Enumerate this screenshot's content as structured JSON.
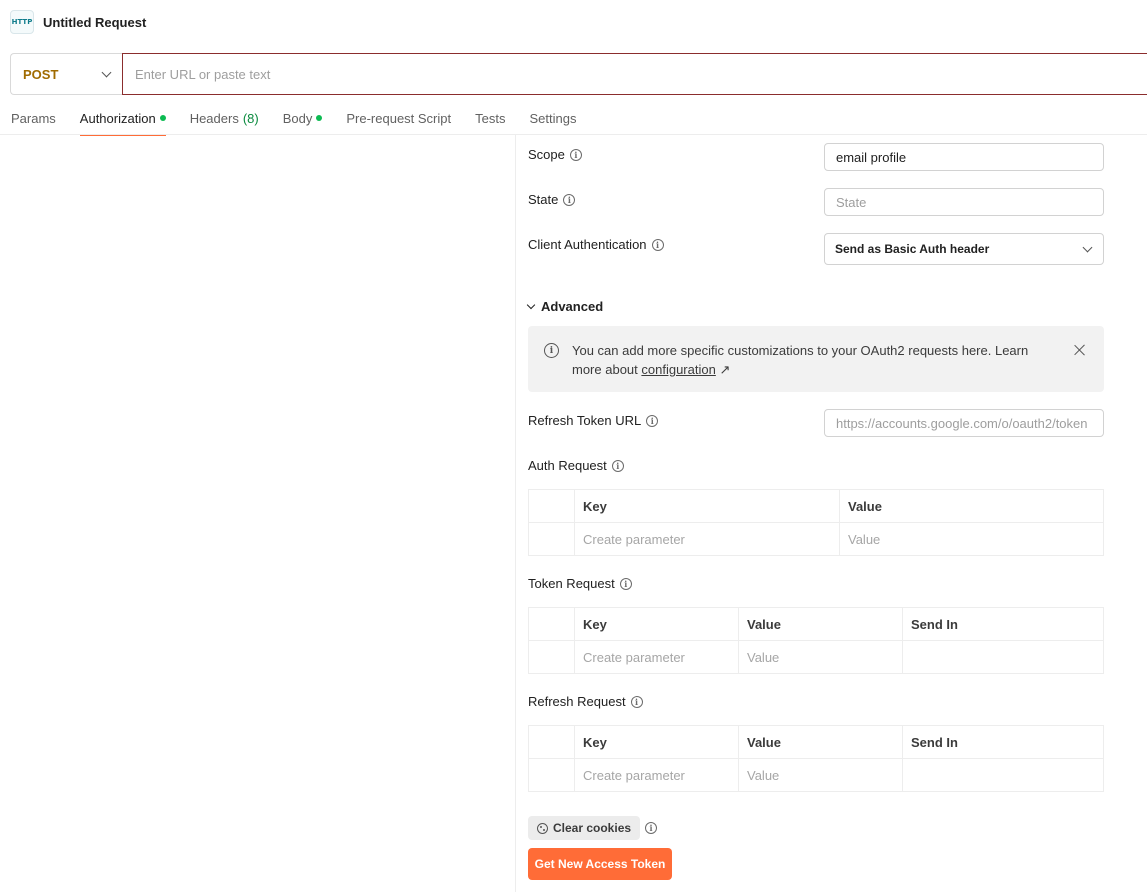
{
  "header": {
    "icon_text": "HTTP",
    "title": "Untitled Request"
  },
  "request": {
    "method": "POST",
    "url_placeholder": "Enter URL or paste text",
    "url_value": ""
  },
  "tabs": [
    {
      "label": "Params"
    },
    {
      "label": "Authorization",
      "dot": true,
      "active": true
    },
    {
      "label": "Headers",
      "count": "(8)"
    },
    {
      "label": "Body",
      "dot": true
    },
    {
      "label": "Pre-request Script"
    },
    {
      "label": "Tests"
    },
    {
      "label": "Settings"
    }
  ],
  "auth": {
    "scope": {
      "label": "Scope",
      "value": "email profile"
    },
    "state": {
      "label": "State",
      "placeholder": "State"
    },
    "client_auth": {
      "label": "Client Authentication",
      "value": "Send as Basic Auth header"
    },
    "advanced_label": "Advanced",
    "notice": {
      "text": "You can add more specific customizations to your OAuth2 requests here. Learn more about",
      "link": "configuration",
      "link_arrow": "↗"
    },
    "refresh_token_url": {
      "label": "Refresh Token URL",
      "placeholder": "https://accounts.google.com/o/oauth2/token"
    },
    "auth_request": {
      "label": "Auth Request",
      "headers": [
        "Key",
        "Value"
      ],
      "row": [
        "Create parameter",
        "Value"
      ]
    },
    "token_request": {
      "label": "Token Request",
      "headers": [
        "Key",
        "Value",
        "Send In"
      ],
      "row": [
        "Create parameter",
        "Value",
        ""
      ]
    },
    "refresh_request": {
      "label": "Refresh Request",
      "headers": [
        "Key",
        "Value",
        "Send In"
      ],
      "row": [
        "Create parameter",
        "Value",
        ""
      ]
    },
    "clear_cookies": "Clear cookies",
    "get_token": "Get New Access Token"
  },
  "colors": {
    "accent": "#ff6c37",
    "method": "#a06b00",
    "dot": "#0cbb52",
    "url_border": "#8b2d2d"
  },
  "icons": {
    "info": "info-icon",
    "close": "close-icon",
    "chevron": "chevron-down-icon",
    "cookie": "cookie-icon"
  }
}
